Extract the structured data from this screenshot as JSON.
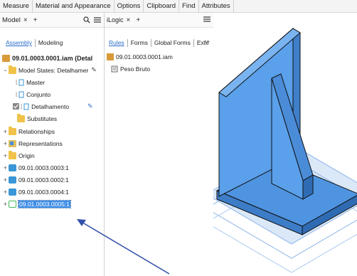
{
  "ribbon": {
    "tabs": [
      "Measure",
      "Material and Appearance",
      "Options",
      "Clipboard",
      "Find",
      "Attributes"
    ]
  },
  "model_panel": {
    "title": "Model",
    "close_glyph": "×",
    "add_glyph": "+",
    "search_icon": "search-icon",
    "menu_icon": "menu-icon",
    "subtabs": [
      "Assembly",
      "Modeling"
    ]
  },
  "tree": {
    "root": "09.01.0003.0001.iam (Detal",
    "model_states": "Model States: Detalhamer",
    "states": [
      "Master",
      "Conjunto",
      "Detalhamento"
    ],
    "substitutes": "Substitutes",
    "relationships": "Relationships",
    "representations": "Representations",
    "origin": "Origin",
    "components": [
      "09.01.0003.0003:1",
      "09.01.0003.0002:1",
      "09.01.0003.0004:1",
      "09.01.0003.0005:1"
    ]
  },
  "ilogic_panel": {
    "title": "iLogic",
    "close_glyph": "×",
    "add_glyph": "+",
    "menu_icon": "menu-icon",
    "subtabs": [
      "Rules",
      "Forms",
      "Global Forms",
      "Exte"
    ],
    "doc": "09.01.0003.0001.iam",
    "rule": "Peso Bruto"
  },
  "colors": {
    "selection": "#3d8ee6",
    "accent": "#2a6bc8",
    "part_blue": "#4f94e0",
    "arrow": "#2f4fa8"
  }
}
